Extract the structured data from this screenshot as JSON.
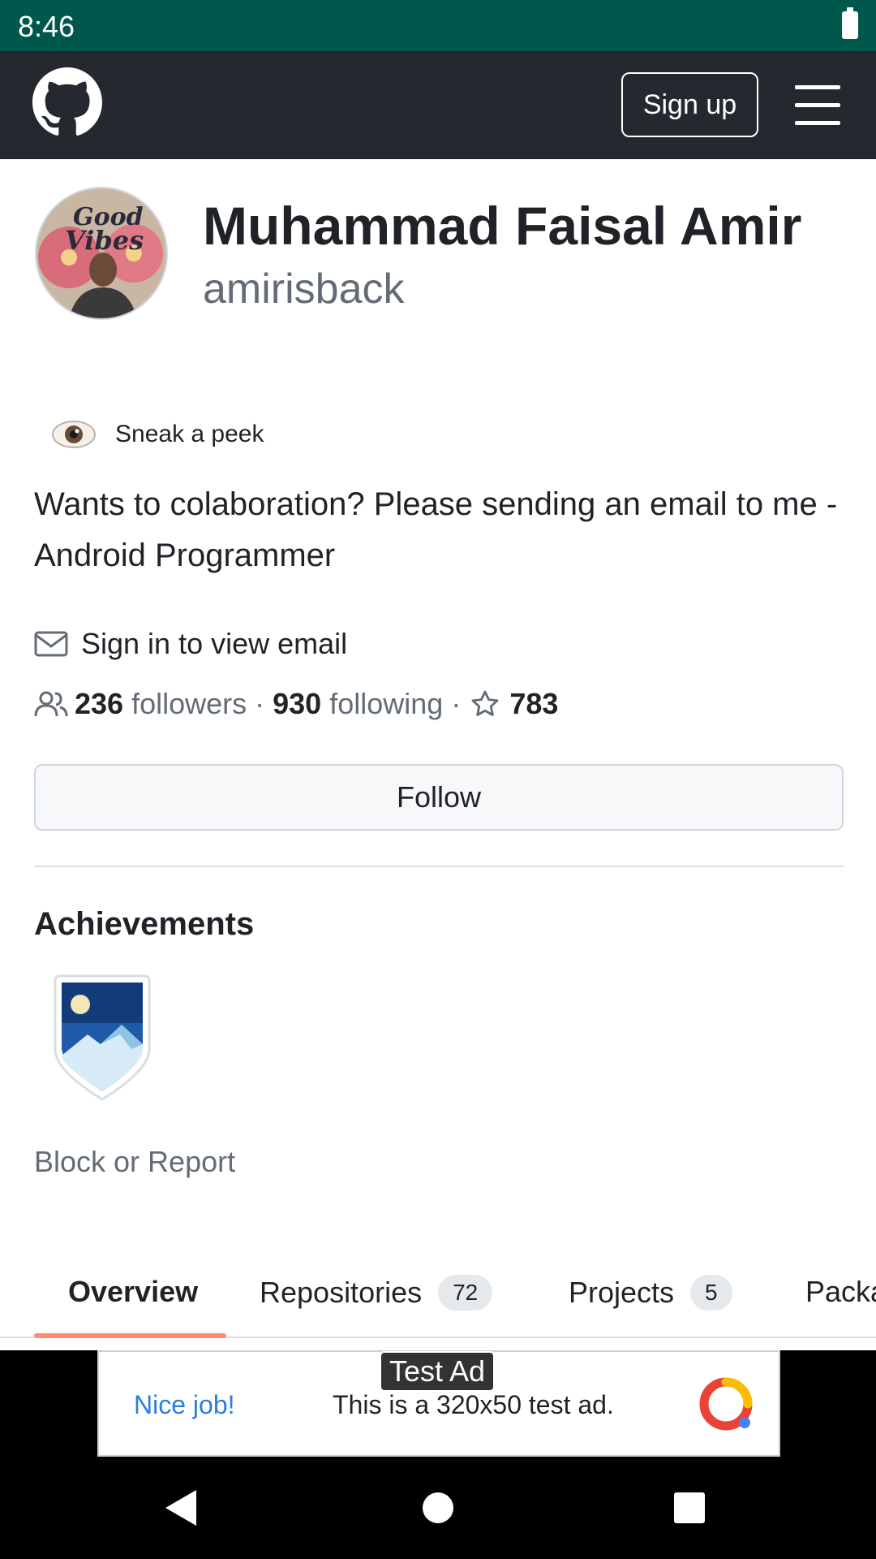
{
  "status_bar": {
    "time": "8:46"
  },
  "header": {
    "signup_label": "Sign up"
  },
  "profile": {
    "name": "Muhammad Faisal Amir",
    "login": "amirisback",
    "sneak_peek_label": "Sneak a peek",
    "bio": "Wants to colaboration? Please sending an email to me - Android Programmer",
    "email_label": "Sign in to view email",
    "followers_count": "236",
    "followers_label": "followers",
    "following_count": "930",
    "following_label": "following",
    "separator": "·",
    "stars_count": "783",
    "follow_label": "Follow"
  },
  "achievements": {
    "title": "Achievements"
  },
  "block_report_label": "Block or Report",
  "tabs": [
    {
      "label": "Overview",
      "count": "",
      "active": true
    },
    {
      "label": "Repositories",
      "count": "72"
    },
    {
      "label": "Projects",
      "count": "5"
    },
    {
      "label": "Packa",
      "count": ""
    }
  ],
  "ad": {
    "tag": "Test Ad",
    "nice": "Nice job!",
    "text": "This is a 320x50 test ad."
  },
  "colors": {
    "status_bar": "#00574b",
    "header": "#24292f",
    "tab_underline": "#fd8c73",
    "ad_accent": "#2a7de1"
  },
  "icons": [
    "github-logo-icon",
    "menu-icon",
    "eye-icon",
    "mail-icon",
    "people-icon",
    "star-icon",
    "achievement-badge-icon",
    "back-icon",
    "home-icon",
    "recents-icon"
  ]
}
